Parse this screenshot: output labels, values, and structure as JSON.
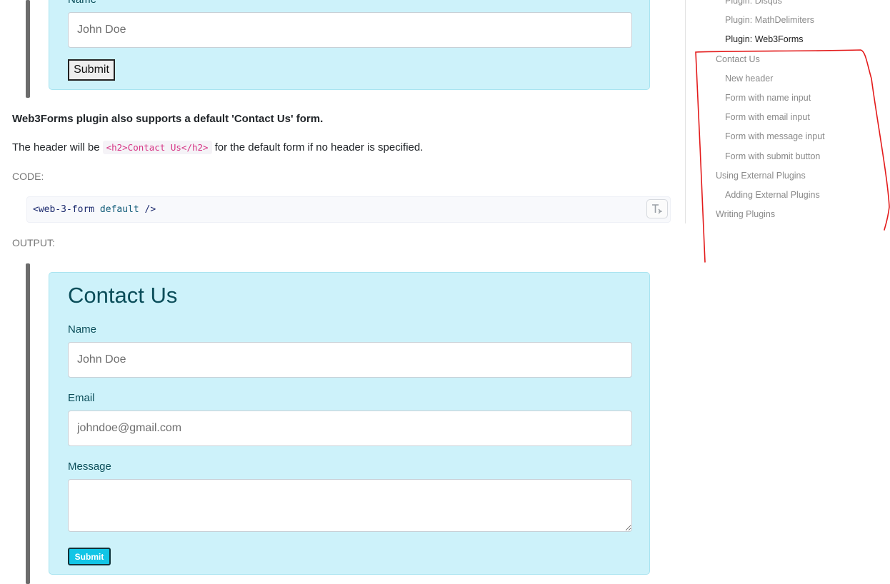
{
  "top_form": {
    "name_label": "Name",
    "name_placeholder": "John Doe",
    "submit_label": "Submit"
  },
  "content": {
    "intro_bold": "Web3Forms plugin also supports a default 'Contact Us' form.",
    "header_text_before": "The header will be",
    "header_code": "<h2>Contact Us</h2>",
    "header_text_after": "for the default form if no header is specified.",
    "code_label": "CODE:",
    "code_tag_open": "<web-3-form",
    "code_attr": "default",
    "code_tag_close": "/>",
    "copy_icon": "format-code-icon",
    "output_label": "OUTPUT:"
  },
  "contact_form": {
    "title": "Contact Us",
    "name_label": "Name",
    "name_placeholder": "John Doe",
    "email_label": "Email",
    "email_placeholder": "johndoe@gmail.com",
    "message_label": "Message",
    "message_placeholder": "",
    "submit_label": "Submit"
  },
  "toc": {
    "items": [
      {
        "label": "Plugin: Disqus",
        "level": 2,
        "active": false
      },
      {
        "label": "Plugin: MathDelimiters",
        "level": 2,
        "active": false
      },
      {
        "label": "Plugin: Web3Forms",
        "level": 2,
        "active": true
      },
      {
        "label": "Contact Us",
        "level": 1,
        "active": false
      },
      {
        "label": "New header",
        "level": 2,
        "active": false
      },
      {
        "label": "Form with name input",
        "level": 2,
        "active": false
      },
      {
        "label": "Form with email input",
        "level": 2,
        "active": false
      },
      {
        "label": "Form with message input",
        "level": 2,
        "active": false
      },
      {
        "label": "Form with submit button",
        "level": 2,
        "active": false
      },
      {
        "label": "Using External Plugins",
        "level": 1,
        "active": false
      },
      {
        "label": "Adding External Plugins",
        "level": 2,
        "active": false
      },
      {
        "label": "Writing Plugins",
        "level": 1,
        "active": false
      }
    ]
  },
  "colors": {
    "form_bg": "#cdf2fa",
    "form_text": "#0b4e5a",
    "submit_bg": "#11c5e6",
    "inline_code": "#d63384",
    "annotation": "#e31b1b"
  }
}
